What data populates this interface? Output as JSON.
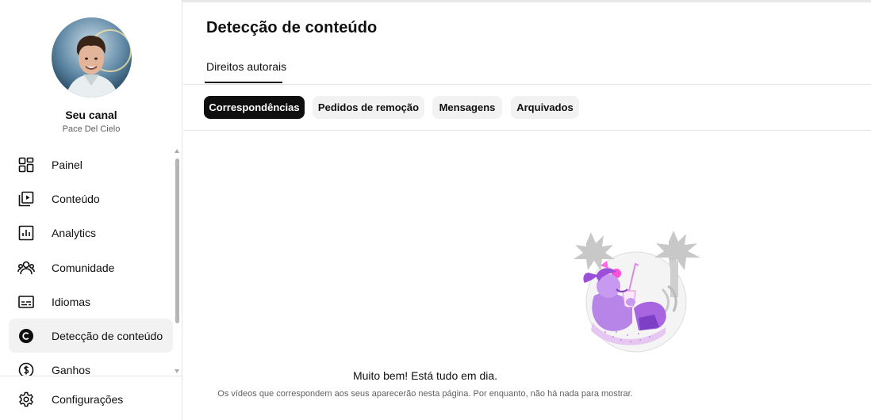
{
  "channel": {
    "title": "Seu canal",
    "name": "Pace Del Cielo"
  },
  "sidebar": {
    "items": [
      {
        "label": "Painel",
        "icon": "dashboard-icon"
      },
      {
        "label": "Conteúdo",
        "icon": "content-icon"
      },
      {
        "label": "Analytics",
        "icon": "analytics-icon"
      },
      {
        "label": "Comunidade",
        "icon": "community-icon"
      },
      {
        "label": "Idiomas",
        "icon": "subtitles-icon"
      },
      {
        "label": "Detecção de conteúdo",
        "icon": "copyright-icon",
        "active": true
      },
      {
        "label": "Ganhos",
        "icon": "earnings-icon"
      }
    ],
    "footer": {
      "label": "Configurações",
      "icon": "gear-icon"
    }
  },
  "main": {
    "title": "Detecção de conteúdo",
    "tab": "Direitos autorais",
    "chips": [
      {
        "label": "Correspondências",
        "active": true
      },
      {
        "label": "Pedidos de remoção"
      },
      {
        "label": "Mensagens"
      },
      {
        "label": "Arquivados"
      }
    ],
    "empty": {
      "title": "Muito bem! Está tudo em dia.",
      "description": "Os vídeos que correspondem aos seus aparecerão nesta página. Por enquanto, não há nada para mostrar."
    }
  },
  "colors": {
    "accent_dark": "#0f0f0f",
    "illustration_purple": "#a766e0",
    "illustration_pink": "#ff4fd8"
  }
}
